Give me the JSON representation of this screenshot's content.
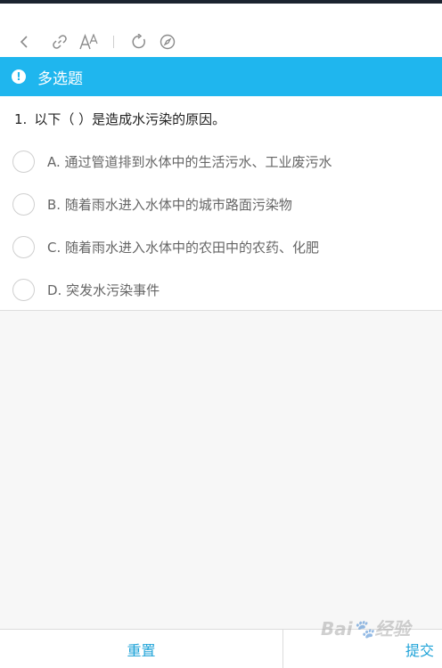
{
  "toolbar": {
    "icons": [
      "back-icon",
      "link-icon",
      "font-size-icon",
      "refresh-icon",
      "compass-icon"
    ]
  },
  "section": {
    "icon": "alert-icon",
    "title": "多选题"
  },
  "question": {
    "number": "1.",
    "text": "以下（ ）是造成水污染的原因。",
    "options": [
      {
        "letter": "A.",
        "text": "通过管道排到水体中的生活污水、工业废污水"
      },
      {
        "letter": "B.",
        "text": "随着雨水进入水体中的城市路面污染物"
      },
      {
        "letter": "C.",
        "text": "随着雨水进入水体中的农田中的农药、化肥"
      },
      {
        "letter": "D.",
        "text": "突发水污染事件"
      }
    ]
  },
  "footer": {
    "reset_label": "重置",
    "submit_label": "提交"
  },
  "watermark": {
    "text": "Bai🐾经验"
  },
  "colors": {
    "accent": "#1fb6ee",
    "link": "#1fa3d8",
    "topbar": "#1c2430"
  }
}
